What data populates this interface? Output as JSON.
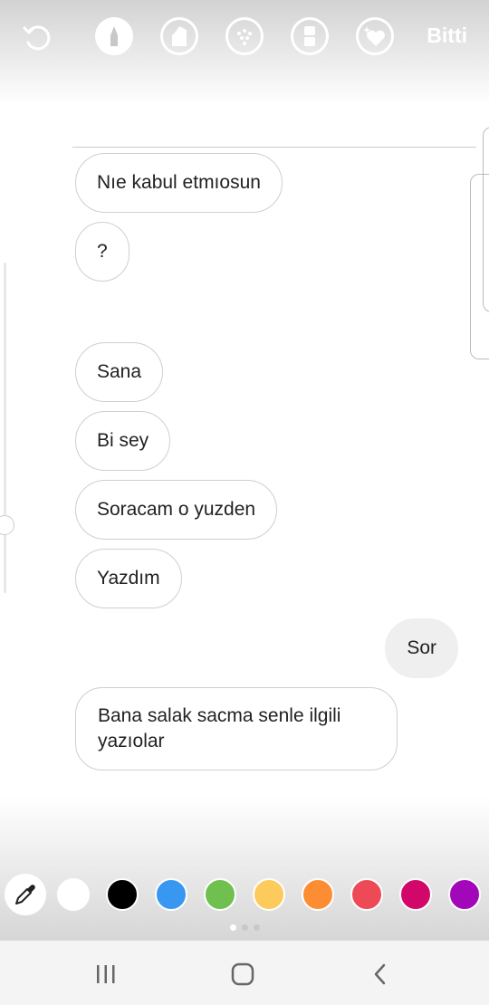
{
  "toolbar": {
    "undo_icon": "undo-icon",
    "tools": [
      {
        "name": "pen",
        "icon": "pen-icon",
        "active": true
      },
      {
        "name": "marker",
        "icon": "marker-icon",
        "active": false
      },
      {
        "name": "neon",
        "icon": "neon-brush-icon",
        "active": false
      },
      {
        "name": "eraser",
        "icon": "eraser-icon",
        "active": false
      },
      {
        "name": "sticker",
        "icon": "heart-sparkle-icon",
        "active": false
      }
    ],
    "done_label": "Bitti"
  },
  "messages": [
    {
      "text": "Nıe kabul etmıosun",
      "sender": "other"
    },
    {
      "text": "?",
      "sender": "other"
    },
    {
      "text": "Sana",
      "sender": "other"
    },
    {
      "text": "Bi sey",
      "sender": "other"
    },
    {
      "text": "Soracam o yuzden",
      "sender": "other"
    },
    {
      "text": "Yazdım",
      "sender": "other"
    },
    {
      "text": "Sor",
      "sender": "me"
    },
    {
      "text": "Bana salak sacma senle ilgili yazıolar",
      "sender": "other"
    }
  ],
  "palette": {
    "eyedropper_icon": "eyedropper-icon",
    "colors": [
      "#ffffff",
      "#000000",
      "#3897f0",
      "#70c050",
      "#fdcb5c",
      "#fd8d32",
      "#ed4956",
      "#d10869",
      "#a307ba"
    ],
    "page_count": 3,
    "active_page": 0
  },
  "navbar": {
    "recents_icon": "recents-icon",
    "home_icon": "home-icon",
    "back_icon": "back-icon"
  }
}
